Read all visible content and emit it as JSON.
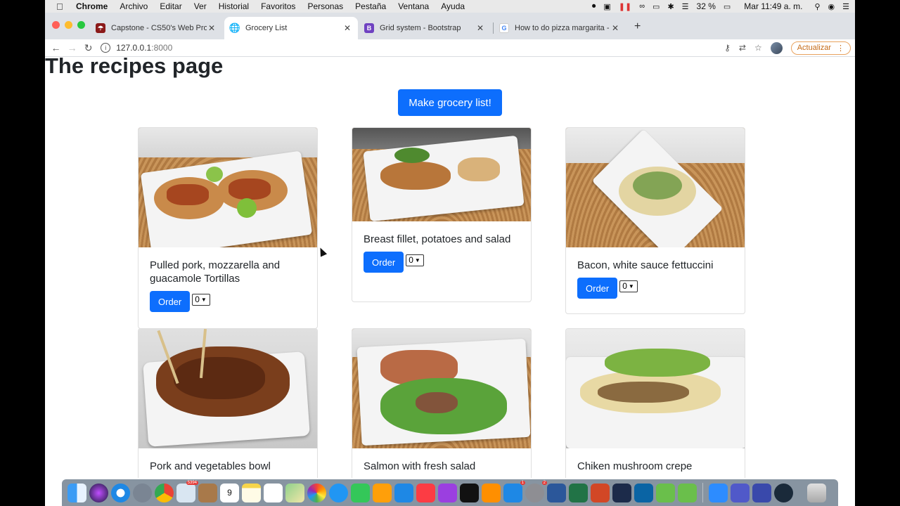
{
  "menubar": {
    "items": [
      "Chrome",
      "Archivo",
      "Editar",
      "Ver",
      "Historial",
      "Favoritos",
      "Personas",
      "Pestaña",
      "Ventana",
      "Ayuda"
    ],
    "battery": "32 %",
    "clock": "Mar 11:49 a. m."
  },
  "tabs": [
    {
      "title": "Capstone - CS50's Web Progra",
      "favicon": "harvard-shield"
    },
    {
      "title": "Grocery List",
      "favicon": "globe"
    },
    {
      "title": "Grid system - Bootstrap",
      "favicon": "B"
    },
    {
      "title": "How to do pizza margarita - Bu",
      "favicon": "G"
    }
  ],
  "address": {
    "host": "127.0.0.1",
    "port": ":8000"
  },
  "update_label": "Actualizar",
  "page": {
    "title": "The recipes page",
    "make_button": "Make grocery list!",
    "order_label": "Order",
    "qty_default": "0",
    "recipes": [
      {
        "name": "Pulled pork, mozzarella and guacamole Tortillas"
      },
      {
        "name": "Breast fillet, potatoes and salad"
      },
      {
        "name": "Bacon, white sauce fettuccini"
      },
      {
        "name": "Pork and vegetables bowl"
      },
      {
        "name": "Salmon with fresh salad"
      },
      {
        "name": "Chiken mushroom crepe"
      }
    ]
  },
  "dock": {
    "badges": [
      "5394",
      "2",
      "1"
    ],
    "calendar_day": "9"
  },
  "colors": {
    "primary": "#0d6efd",
    "tab_strip": "#dee1e6",
    "update": "#c56a16"
  }
}
